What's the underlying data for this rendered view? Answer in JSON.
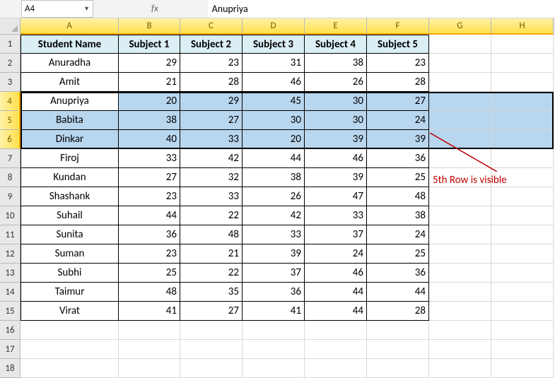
{
  "name_box": "A4",
  "fx_label": "fx",
  "formula_value": "Anupriya",
  "column_letters": [
    "A",
    "B",
    "C",
    "D",
    "E",
    "F",
    "G",
    "H"
  ],
  "active_cols": [
    "A",
    "B",
    "C",
    "D",
    "E",
    "F",
    "G",
    "H"
  ],
  "row_numbers": [
    1,
    2,
    3,
    4,
    5,
    6,
    7,
    8,
    9,
    10,
    11,
    12,
    13,
    14,
    15,
    16,
    17,
    18
  ],
  "active_rows": [
    4,
    5,
    6
  ],
  "headers": [
    "Student Name",
    "Subject 1",
    "Subject 2",
    "Subject 3",
    "Subject 4",
    "Subject 5"
  ],
  "data": [
    {
      "name": "Anuradha",
      "s": [
        29,
        23,
        31,
        38,
        23
      ]
    },
    {
      "name": "Amit",
      "s": [
        21,
        28,
        46,
        26,
        28
      ]
    },
    {
      "name": "Anupriya",
      "s": [
        20,
        29,
        45,
        30,
        27
      ]
    },
    {
      "name": "Babita",
      "s": [
        38,
        27,
        30,
        30,
        24
      ]
    },
    {
      "name": "Dinkar",
      "s": [
        40,
        33,
        20,
        39,
        39
      ]
    },
    {
      "name": "Firoj",
      "s": [
        33,
        42,
        44,
        46,
        36
      ]
    },
    {
      "name": "Kundan",
      "s": [
        27,
        32,
        38,
        39,
        25
      ]
    },
    {
      "name": "Shashank",
      "s": [
        23,
        33,
        26,
        47,
        48
      ]
    },
    {
      "name": "Suhail",
      "s": [
        44,
        22,
        42,
        33,
        38
      ]
    },
    {
      "name": "Sunita",
      "s": [
        36,
        48,
        33,
        37,
        24
      ]
    },
    {
      "name": "Suman",
      "s": [
        23,
        21,
        39,
        24,
        25
      ]
    },
    {
      "name": "Subhi",
      "s": [
        25,
        22,
        37,
        46,
        36
      ]
    },
    {
      "name": "Taimur",
      "s": [
        48,
        35,
        36,
        44,
        44
      ]
    },
    {
      "name": "Virat",
      "s": [
        41,
        27,
        41,
        44,
        28
      ]
    }
  ],
  "annotation_text": "5th Row is visible",
  "row_count": 18
}
